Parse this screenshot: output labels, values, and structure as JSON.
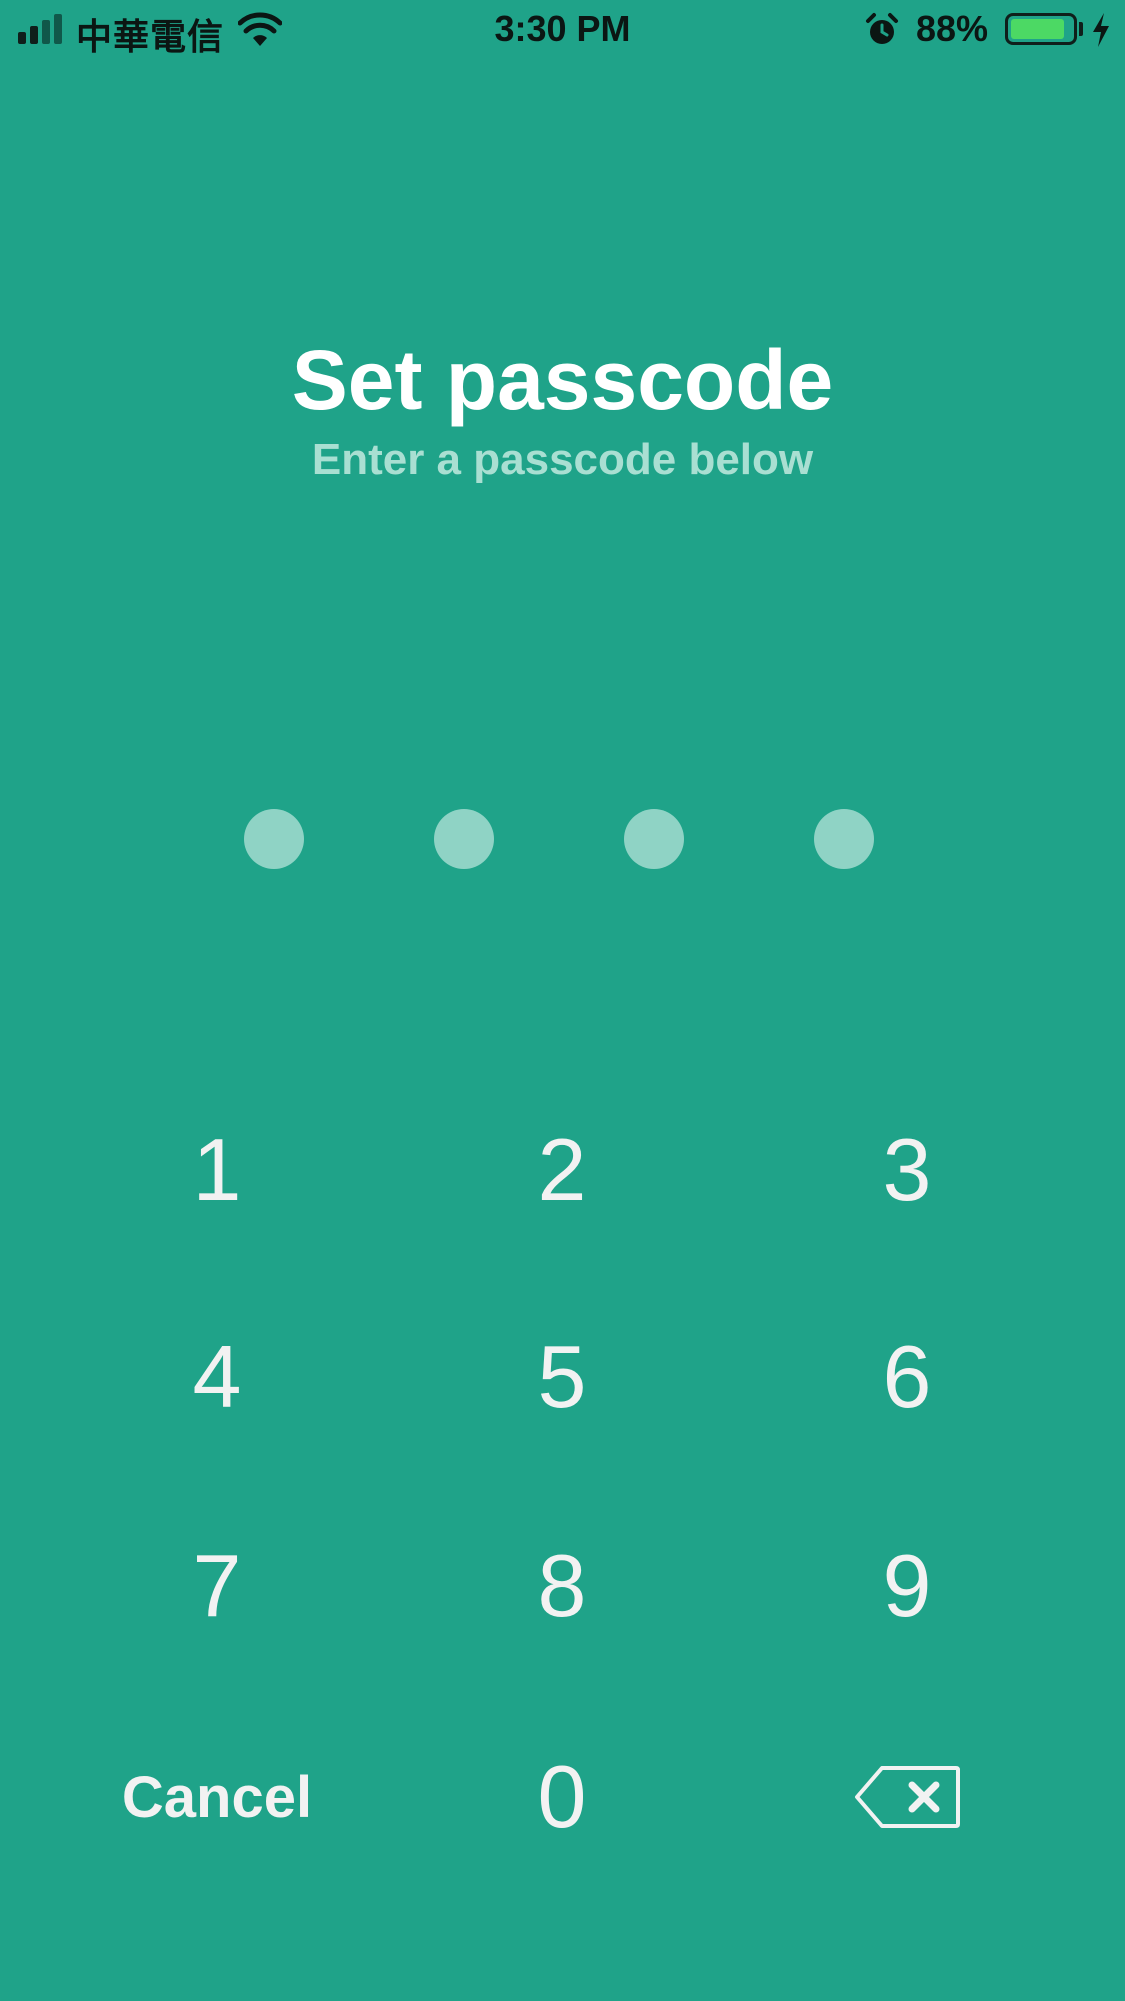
{
  "status_bar": {
    "carrier": "中華電信",
    "time": "3:30 PM",
    "battery_percent": "88%",
    "battery_level": 0.88,
    "signal_bars": 4,
    "icons": [
      "signal-icon",
      "wifi-icon",
      "alarm-icon",
      "battery-icon",
      "charging-bolt-icon"
    ]
  },
  "header": {
    "title": "Set passcode",
    "subtitle": "Enter a passcode below"
  },
  "passcode": {
    "length": 4,
    "entered": 0
  },
  "keypad": {
    "keys": [
      "1",
      "2",
      "3",
      "4",
      "5",
      "6",
      "7",
      "8",
      "9",
      "0"
    ],
    "cancel_label": "Cancel",
    "delete_icon": "delete-backspace-icon"
  },
  "colors": {
    "background": "#1fa389",
    "title": "#ffffff",
    "subtitle": "#a9dfd2",
    "dot": "#8fd3c5",
    "key_text": "#f2f2f2",
    "battery_fill": "#4cd964"
  }
}
